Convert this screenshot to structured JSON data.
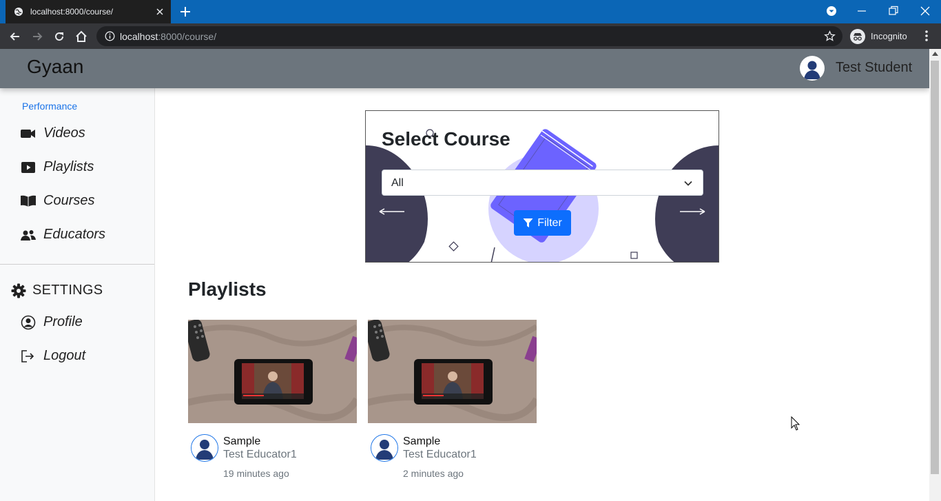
{
  "browser": {
    "tab_title": "localhost:8000/course/",
    "url_host": "localhost",
    "url_rest": ":8000/course/",
    "incognito_label": "Incognito"
  },
  "app": {
    "brand": "Gyaan",
    "user_name": "Test Student"
  },
  "sidebar": {
    "performance_label": "Performance",
    "items": [
      {
        "label": "Videos",
        "icon": "video-camera-icon"
      },
      {
        "label": "Playlists",
        "icon": "youtube-play-icon"
      },
      {
        "label": "Courses",
        "icon": "book-icon"
      },
      {
        "label": "Educators",
        "icon": "users-icon"
      }
    ],
    "settings_label": "SETTINGS",
    "settings_items": [
      {
        "label": "Profile",
        "icon": "user-circle-icon"
      },
      {
        "label": "Logout",
        "icon": "sign-out-icon"
      }
    ]
  },
  "banner": {
    "title": "Select Course",
    "select_value": "All",
    "filter_label": "Filter"
  },
  "playlists": {
    "title": "Playlists",
    "cards": [
      {
        "title": "Sample",
        "educator": "Test Educator1",
        "time": "19 minutes ago"
      },
      {
        "title": "Sample",
        "educator": "Test Educator1",
        "time": "2 minutes ago"
      }
    ]
  },
  "colors": {
    "tabstrip": "#0b66b6",
    "navbar": "#6c757d",
    "primary": "#0d6efd",
    "banner_dark": "#3f3d56",
    "banner_accent": "#6c63ff"
  }
}
